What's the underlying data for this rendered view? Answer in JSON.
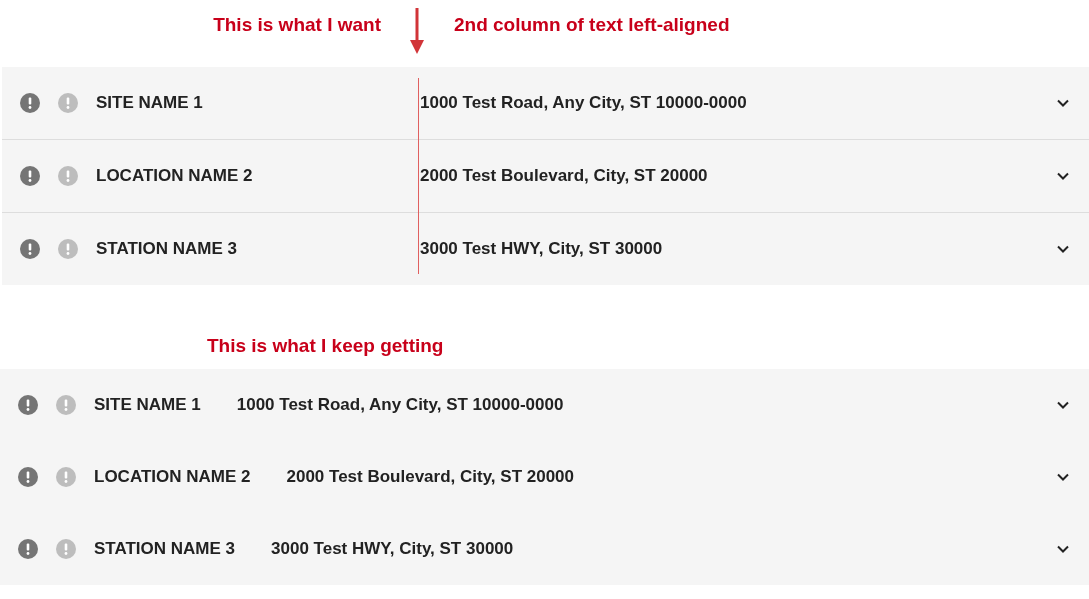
{
  "annotations": {
    "want": "This is what I want",
    "alignment_note": "2nd column of text left-aligned",
    "getting": "This is what I keep getting"
  },
  "panels": [
    {
      "kind": "fixed-column",
      "rows": [
        {
          "name": "SITE NAME 1",
          "address": "1000 Test Road, Any City, ST 10000-0000"
        },
        {
          "name": "LOCATION NAME 2",
          "address": "2000 Test Boulevard, City, ST 20000"
        },
        {
          "name": "STATION NAME 3",
          "address": "3000 Test HWY, City, ST 30000"
        }
      ]
    },
    {
      "kind": "inline",
      "rows": [
        {
          "name": "SITE NAME 1",
          "address": "1000 Test Road, Any City, ST 10000-0000"
        },
        {
          "name": "LOCATION NAME 2",
          "address": "2000 Test Boulevard, City, ST 20000"
        },
        {
          "name": "STATION NAME 3",
          "address": "3000 Test HWY, City, ST 30000"
        }
      ]
    }
  ]
}
